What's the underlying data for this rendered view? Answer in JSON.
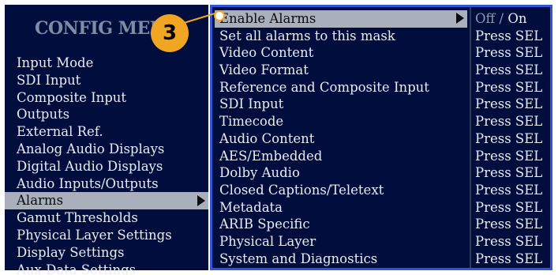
{
  "menu_title": "CONFIG MENU",
  "callout_number": "3",
  "left_menu": [
    {
      "label": "Input Mode"
    },
    {
      "label": "SDI Input"
    },
    {
      "label": "Composite Input"
    },
    {
      "label": "Outputs"
    },
    {
      "label": "External Ref."
    },
    {
      "label": "Analog Audio Displays"
    },
    {
      "label": "Digital Audio Displays"
    },
    {
      "label": "Audio Inputs/Outputs"
    },
    {
      "label": "Alarms",
      "selected": true
    },
    {
      "label": "Gamut Thresholds"
    },
    {
      "label": "Physical Layer Settings"
    },
    {
      "label": "Display Settings"
    },
    {
      "label": "Aux Data Settings"
    }
  ],
  "alarms_submenu": {
    "enable_alarms": {
      "label": "Enable Alarms",
      "off": "Off",
      "separator": "/",
      "on": "On",
      "selected_value": "On"
    },
    "rows": [
      {
        "label": "Set all alarms to this mask",
        "value": "Press SEL"
      },
      {
        "label": "Video Content",
        "value": "Press SEL"
      },
      {
        "label": "Video Format",
        "value": "Press SEL"
      },
      {
        "label": "Reference and Composite Input",
        "value": "Press SEL"
      },
      {
        "label": "SDI Input",
        "value": "Press SEL"
      },
      {
        "label": "Timecode",
        "value": "Press SEL"
      },
      {
        "label": "Audio Content",
        "value": "Press SEL"
      },
      {
        "label": "AES/Embedded",
        "value": "Press SEL"
      },
      {
        "label": "Dolby Audio",
        "value": "Press SEL"
      },
      {
        "label": "Closed Captions/Teletext",
        "value": "Press SEL"
      },
      {
        "label": "Metadata",
        "value": "Press SEL"
      },
      {
        "label": "ARIB Specific",
        "value": "Press SEL"
      },
      {
        "label": "Physical Layer",
        "value": "Press SEL"
      },
      {
        "label": "System and Diagnostics",
        "value": "Press SEL"
      }
    ]
  },
  "colors": {
    "panel_background": "#010d3d",
    "selection_highlight": "#aab0bb",
    "submenu_border": "#2f56d8",
    "callout": "#f0a623"
  }
}
